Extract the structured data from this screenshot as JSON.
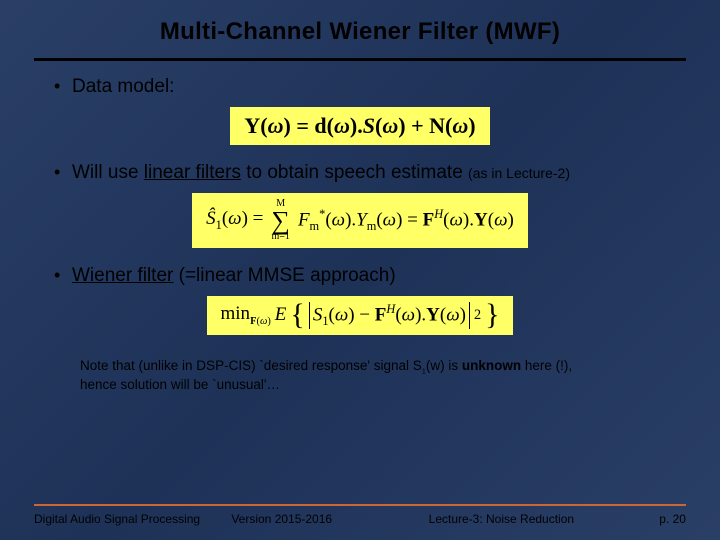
{
  "title": "Multi-Channel Wiener Filter (MWF)",
  "bullets": {
    "data_model": "Data model:",
    "linear_filters_pre": "Will use ",
    "linear_filters_underlined": "linear filters",
    "linear_filters_post": " to obtain speech estimate ",
    "linear_filters_small": "(as in Lecture-2)",
    "wiener_pre": "",
    "wiener_underlined": "Wiener filter",
    "wiener_post": "  (=linear MMSE approach)"
  },
  "equations": {
    "eq1": "Y(ω) = d(ω).S(ω) + N(ω)",
    "eq2": {
      "lhs": "Ŝ",
      "lhs_sub": "1",
      "lhs_arg": "(ω) = ",
      "sum_top": "M",
      "sum_bot": "m=1",
      "term1_F": "F",
      "term1_Fsub": "m",
      "term1_Fsup": "*",
      "term1_arg": "(ω).Y",
      "term1_Ysub": "m",
      "term1_arg2": "(ω) = ",
      "rhs_F": "F",
      "rhs_Fsup": "H",
      "rhs_arg": "(ω).Y(ω)"
    },
    "eq3": {
      "min": "min",
      "min_sub": "F(ω)",
      "E": "E",
      "inside_S": "S",
      "inside_Ssub": "1",
      "inside_arg1": "(ω) − ",
      "inside_F": "F",
      "inside_Fsup": "H",
      "inside_arg2": "(ω).Y(ω)",
      "outer_sup": "2"
    }
  },
  "note": {
    "line1_pre": "Note that (unlike in DSP-CIS) `desired response' signal S",
    "line1_sub": "1",
    "line1_mid": "(w) is ",
    "line1_bold": "unknown",
    "line1_post": " here (!),",
    "line2": "hence solution will be `unusual'…"
  },
  "footer": {
    "left": "Digital Audio Signal Processing",
    "center": "Version 2015-2016",
    "right": "Lecture-3: Noise Reduction",
    "page": "p. 20"
  }
}
